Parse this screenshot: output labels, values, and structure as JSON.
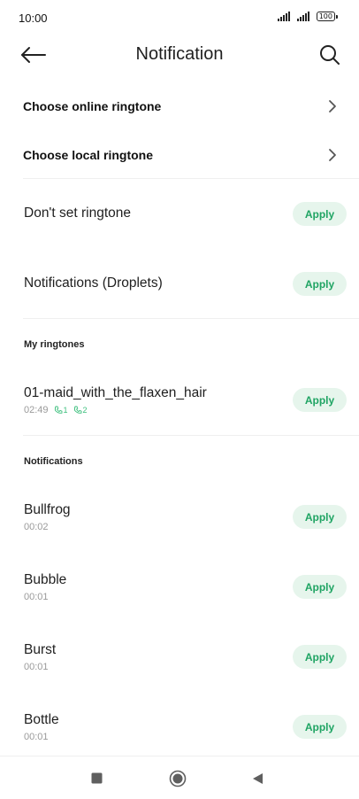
{
  "status_bar": {
    "time": "10:00",
    "battery": "100"
  },
  "header": {
    "title": "Notification",
    "back_icon": "arrow-left-icon",
    "search_icon": "search-icon"
  },
  "options": [
    {
      "label": "Choose online ringtone",
      "icon": "chevron-right-icon"
    },
    {
      "label": "Choose local ringtone",
      "icon": "chevron-right-icon"
    }
  ],
  "apply_label": "Apply",
  "general_tones": [
    {
      "name": "Don't set ringtone"
    },
    {
      "name": "Notifications (Droplets)"
    }
  ],
  "my_ringtones": {
    "title": "My ringtones",
    "items": [
      {
        "name": "01-maid_with_the_flaxen_hair",
        "duration": "02:49",
        "sim1": "1",
        "sim2": "2"
      }
    ]
  },
  "notifications": {
    "title": "Notifications",
    "items": [
      {
        "name": "Bullfrog",
        "duration": "00:02"
      },
      {
        "name": "Bubble",
        "duration": "00:01"
      },
      {
        "name": "Burst",
        "duration": "00:01"
      },
      {
        "name": "Bottle",
        "duration": "00:01"
      }
    ]
  },
  "colors": {
    "accent": "#1fa463",
    "apply_bg": "#e6f5ec",
    "sim_green": "#3cbf7d"
  }
}
